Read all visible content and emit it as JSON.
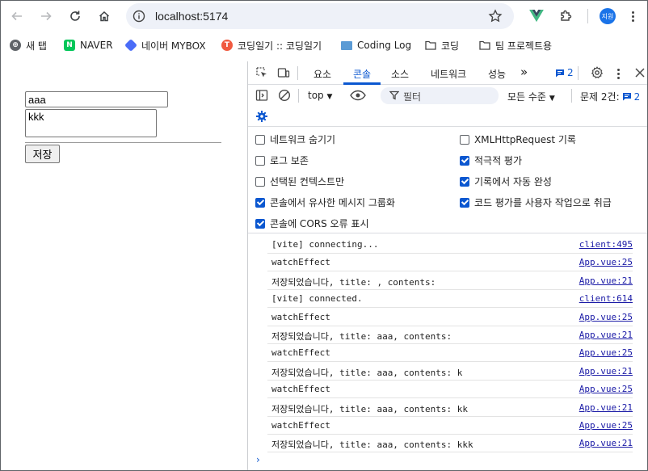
{
  "browser": {
    "url": "localhost:5174",
    "profile_initials": "지원",
    "bookmarks": [
      {
        "label": "새 탭",
        "color": "#5f6368",
        "glyph": "⊕"
      },
      {
        "label": "NAVER",
        "color": "#03c75a",
        "glyph": "N"
      },
      {
        "label": "네이버 MYBOX",
        "color": "#4a6cf7",
        "glyph": "◆"
      },
      {
        "label": "코딩일기 :: 코딩일기",
        "color": "#f05a40",
        "glyph": "T"
      },
      {
        "label": "Coding Log",
        "color": "#5b9bd5",
        "glyph": "▭"
      },
      {
        "label": "코딩",
        "color": "#444444",
        "glyph": "folder"
      },
      {
        "label": "팀 프로젝트용",
        "color": "#444444",
        "glyph": "folder"
      }
    ]
  },
  "page": {
    "title_value": "aaa",
    "contents_value": "kkk",
    "save_label": "저장"
  },
  "devtools": {
    "tabs": [
      "요소",
      "콘솔",
      "소스",
      "네트워크",
      "성능"
    ],
    "active_tab": "콘솔",
    "more": "»",
    "message_count": "2",
    "context": "top",
    "filter_placeholder": "필터",
    "levels": "모든 수준",
    "issues_label": "문제 2건:",
    "issues_count": "2",
    "settings": [
      {
        "label": "네트워크 숨기기",
        "checked": false
      },
      {
        "label": "XMLHttpRequest 기록",
        "checked": false
      },
      {
        "label": "로그 보존",
        "checked": false
      },
      {
        "label": "적극적 평가",
        "checked": true
      },
      {
        "label": "선택된 컨텍스트만",
        "checked": false
      },
      {
        "label": "기록에서 자동 완성",
        "checked": true
      },
      {
        "label": "콘솔에서 유사한 메시지 그룹화",
        "checked": true
      },
      {
        "label": "코드 평가를 사용자 작업으로 취급",
        "checked": true
      },
      {
        "label": "콘솔에 CORS 오류 표시",
        "checked": true
      }
    ],
    "logs": [
      {
        "message": "[vite] connecting...",
        "source": "client:495"
      },
      {
        "message": "watchEffect",
        "source": "App.vue:25"
      },
      {
        "message": "저장되었습니다, title: , contents:",
        "source": "App.vue:21"
      },
      {
        "message": "[vite] connected.",
        "source": "client:614"
      },
      {
        "message": "watchEffect",
        "source": "App.vue:25"
      },
      {
        "message": "저장되었습니다, title: aaa, contents:",
        "source": "App.vue:21"
      },
      {
        "message": "watchEffect",
        "source": "App.vue:25"
      },
      {
        "message": "저장되었습니다, title: aaa, contents: k",
        "source": "App.vue:21"
      },
      {
        "message": "watchEffect",
        "source": "App.vue:25"
      },
      {
        "message": "저장되었습니다, title: aaa, contents: kk",
        "source": "App.vue:21"
      },
      {
        "message": "watchEffect",
        "source": "App.vue:25"
      },
      {
        "message": "저장되었습니다, title: aaa, contents: kkk",
        "source": "App.vue:21"
      }
    ],
    "prompt": "›"
  }
}
